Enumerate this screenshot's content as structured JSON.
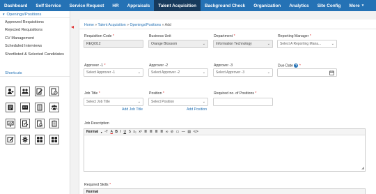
{
  "nav": {
    "items": [
      {
        "label": "Dashboard"
      },
      {
        "label": "Self Service"
      },
      {
        "label": "Service Request"
      },
      {
        "label": "HR"
      },
      {
        "label": "Appraisals"
      },
      {
        "label": "Talent Acquisition"
      },
      {
        "label": "Background Check"
      },
      {
        "label": "Organization"
      },
      {
        "label": "Analytics"
      },
      {
        "label": "Site Config"
      },
      {
        "label": "More"
      }
    ],
    "active_index": 5,
    "more_caret_icon": "caret-down-icon"
  },
  "sidebar": {
    "section_title": "Openings/Positions",
    "section_icon": "caret-down-icon",
    "items": [
      {
        "label": "Approved Requisitions"
      },
      {
        "label": "Rejected Requisitions"
      },
      {
        "label": "CV Management"
      },
      {
        "label": "Scheduled Interviews"
      },
      {
        "label": "Shortlisted & Selected Candidates"
      }
    ],
    "shortcuts_title": "Shortcuts",
    "shortcut_icons": [
      "user-add-icon",
      "users-settings-icon",
      "edit-document-icon",
      "document-schedule-icon",
      "list-document-icon",
      "id-card-icon",
      "document-lines-icon",
      "group-icon",
      "chart-screen-icon",
      "checklist-icon",
      "document-search-icon",
      "clipboard-lines-icon",
      "edit-box-icon",
      "gear-icon",
      "grid-apps-icon",
      "grid-apps-icon"
    ],
    "collapse_icon": "caret-left-icon"
  },
  "breadcrumb": {
    "home": "Home",
    "talent": "Talent Acquisition",
    "openings": "Openings/Positions",
    "current": "Add",
    "separator": "»"
  },
  "form": {
    "requisition_code": {
      "label": "Requisition Code",
      "value": "REQ/012"
    },
    "business_unit": {
      "label": "Business Unit",
      "value": "Orange Blossom"
    },
    "department": {
      "label": "Department",
      "value": "Information Technology"
    },
    "reporting_manager": {
      "label": "Reporting Manager",
      "placeholder": "Select A Reporting Mana..."
    },
    "approver1": {
      "label": "Approver -1",
      "placeholder": "Select Approver -1"
    },
    "approver2": {
      "label": "Approver -2",
      "placeholder": "Select Approver -2"
    },
    "approver3": {
      "label": "Approver -3",
      "placeholder": "Select Approver -3"
    },
    "due_date": {
      "label": "Due Date",
      "help": "?",
      "icon": "calendar-icon",
      "value": ""
    },
    "job_title": {
      "label": "Job Title",
      "placeholder": "Select Job Title",
      "add_link": "Add Job Title"
    },
    "position": {
      "label": "Position",
      "placeholder": "Select Position",
      "add_link": "Add Position"
    },
    "num_positions": {
      "label": "Required no. of Positions",
      "value": ""
    },
    "job_description": {
      "label": "Job Description",
      "format": "Normal"
    },
    "required_skills": {
      "label": "Required Skills",
      "format": "Normal"
    },
    "required_mark": "*"
  },
  "editor_toolbar": [
    "B",
    "I",
    "U",
    "S",
    "x₂",
    "x²",
    "≣",
    "≣",
    "≣",
    "≣",
    "∞",
    "⊘",
    "▭",
    "—",
    "▤",
    "</>"
  ],
  "colors": {
    "nav_bg": "#2572b5",
    "nav_active": "#173a5c",
    "link": "#2572b5",
    "required": "#e03030"
  }
}
